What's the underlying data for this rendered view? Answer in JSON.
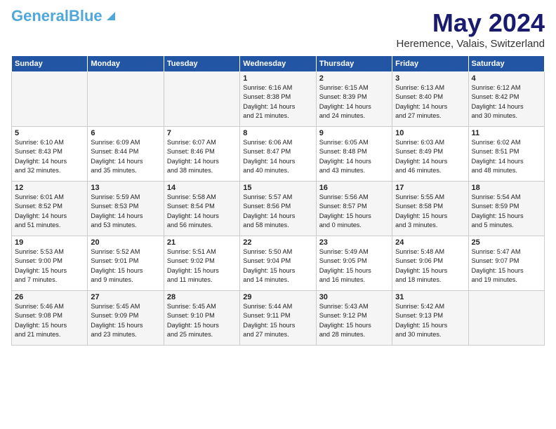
{
  "header": {
    "logo_line1": "General",
    "logo_line2": "Blue",
    "month": "May 2024",
    "location": "Heremence, Valais, Switzerland"
  },
  "days_of_week": [
    "Sunday",
    "Monday",
    "Tuesday",
    "Wednesday",
    "Thursday",
    "Friday",
    "Saturday"
  ],
  "weeks": [
    [
      {
        "day": "",
        "info": ""
      },
      {
        "day": "",
        "info": ""
      },
      {
        "day": "",
        "info": ""
      },
      {
        "day": "1",
        "info": "Sunrise: 6:16 AM\nSunset: 8:38 PM\nDaylight: 14 hours\nand 21 minutes."
      },
      {
        "day": "2",
        "info": "Sunrise: 6:15 AM\nSunset: 8:39 PM\nDaylight: 14 hours\nand 24 minutes."
      },
      {
        "day": "3",
        "info": "Sunrise: 6:13 AM\nSunset: 8:40 PM\nDaylight: 14 hours\nand 27 minutes."
      },
      {
        "day": "4",
        "info": "Sunrise: 6:12 AM\nSunset: 8:42 PM\nDaylight: 14 hours\nand 30 minutes."
      }
    ],
    [
      {
        "day": "5",
        "info": "Sunrise: 6:10 AM\nSunset: 8:43 PM\nDaylight: 14 hours\nand 32 minutes."
      },
      {
        "day": "6",
        "info": "Sunrise: 6:09 AM\nSunset: 8:44 PM\nDaylight: 14 hours\nand 35 minutes."
      },
      {
        "day": "7",
        "info": "Sunrise: 6:07 AM\nSunset: 8:46 PM\nDaylight: 14 hours\nand 38 minutes."
      },
      {
        "day": "8",
        "info": "Sunrise: 6:06 AM\nSunset: 8:47 PM\nDaylight: 14 hours\nand 40 minutes."
      },
      {
        "day": "9",
        "info": "Sunrise: 6:05 AM\nSunset: 8:48 PM\nDaylight: 14 hours\nand 43 minutes."
      },
      {
        "day": "10",
        "info": "Sunrise: 6:03 AM\nSunset: 8:49 PM\nDaylight: 14 hours\nand 46 minutes."
      },
      {
        "day": "11",
        "info": "Sunrise: 6:02 AM\nSunset: 8:51 PM\nDaylight: 14 hours\nand 48 minutes."
      }
    ],
    [
      {
        "day": "12",
        "info": "Sunrise: 6:01 AM\nSunset: 8:52 PM\nDaylight: 14 hours\nand 51 minutes."
      },
      {
        "day": "13",
        "info": "Sunrise: 5:59 AM\nSunset: 8:53 PM\nDaylight: 14 hours\nand 53 minutes."
      },
      {
        "day": "14",
        "info": "Sunrise: 5:58 AM\nSunset: 8:54 PM\nDaylight: 14 hours\nand 56 minutes."
      },
      {
        "day": "15",
        "info": "Sunrise: 5:57 AM\nSunset: 8:56 PM\nDaylight: 14 hours\nand 58 minutes."
      },
      {
        "day": "16",
        "info": "Sunrise: 5:56 AM\nSunset: 8:57 PM\nDaylight: 15 hours\nand 0 minutes."
      },
      {
        "day": "17",
        "info": "Sunrise: 5:55 AM\nSunset: 8:58 PM\nDaylight: 15 hours\nand 3 minutes."
      },
      {
        "day": "18",
        "info": "Sunrise: 5:54 AM\nSunset: 8:59 PM\nDaylight: 15 hours\nand 5 minutes."
      }
    ],
    [
      {
        "day": "19",
        "info": "Sunrise: 5:53 AM\nSunset: 9:00 PM\nDaylight: 15 hours\nand 7 minutes."
      },
      {
        "day": "20",
        "info": "Sunrise: 5:52 AM\nSunset: 9:01 PM\nDaylight: 15 hours\nand 9 minutes."
      },
      {
        "day": "21",
        "info": "Sunrise: 5:51 AM\nSunset: 9:02 PM\nDaylight: 15 hours\nand 11 minutes."
      },
      {
        "day": "22",
        "info": "Sunrise: 5:50 AM\nSunset: 9:04 PM\nDaylight: 15 hours\nand 14 minutes."
      },
      {
        "day": "23",
        "info": "Sunrise: 5:49 AM\nSunset: 9:05 PM\nDaylight: 15 hours\nand 16 minutes."
      },
      {
        "day": "24",
        "info": "Sunrise: 5:48 AM\nSunset: 9:06 PM\nDaylight: 15 hours\nand 18 minutes."
      },
      {
        "day": "25",
        "info": "Sunrise: 5:47 AM\nSunset: 9:07 PM\nDaylight: 15 hours\nand 19 minutes."
      }
    ],
    [
      {
        "day": "26",
        "info": "Sunrise: 5:46 AM\nSunset: 9:08 PM\nDaylight: 15 hours\nand 21 minutes."
      },
      {
        "day": "27",
        "info": "Sunrise: 5:45 AM\nSunset: 9:09 PM\nDaylight: 15 hours\nand 23 minutes."
      },
      {
        "day": "28",
        "info": "Sunrise: 5:45 AM\nSunset: 9:10 PM\nDaylight: 15 hours\nand 25 minutes."
      },
      {
        "day": "29",
        "info": "Sunrise: 5:44 AM\nSunset: 9:11 PM\nDaylight: 15 hours\nand 27 minutes."
      },
      {
        "day": "30",
        "info": "Sunrise: 5:43 AM\nSunset: 9:12 PM\nDaylight: 15 hours\nand 28 minutes."
      },
      {
        "day": "31",
        "info": "Sunrise: 5:42 AM\nSunset: 9:13 PM\nDaylight: 15 hours\nand 30 minutes."
      },
      {
        "day": "",
        "info": ""
      }
    ]
  ]
}
